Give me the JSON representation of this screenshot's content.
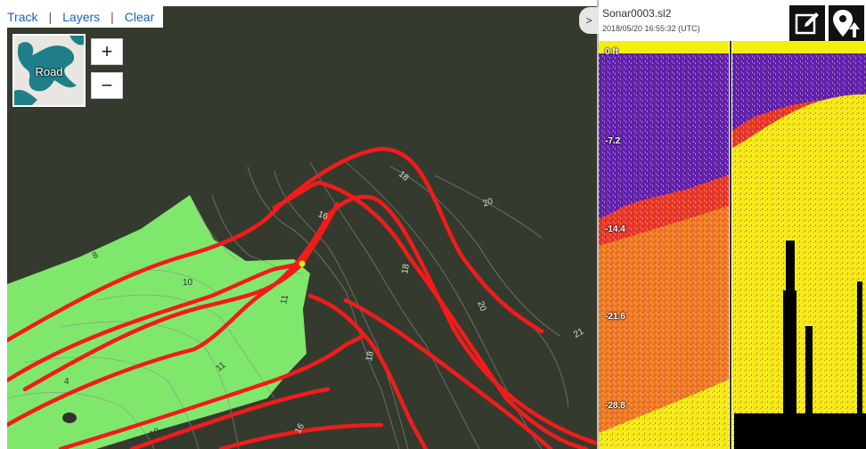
{
  "toolbar": {
    "track": "Track",
    "layers": "Layers",
    "clear": "Clear",
    "separator": "|"
  },
  "basemap": {
    "label": "Road"
  },
  "zoom": {
    "in": "+",
    "out": "−"
  },
  "map": {
    "contour_labels": [
      "15",
      "18",
      "16",
      "20",
      "8",
      "10",
      "11",
      "18",
      "20",
      "11",
      "21",
      "4",
      "18",
      "10",
      "16"
    ]
  },
  "sonar": {
    "collapse": ">",
    "file_name": "Sonar0003.sl2",
    "timestamp": "2018/05/20 16:55:32 (UTC)",
    "edit_icon": "edit-icon",
    "pin_icon": "location-pin-icon",
    "depth_labels": [
      "0 ft",
      "-7.2",
      "-14.4",
      "-21.6",
      "-28.8"
    ]
  },
  "colors": {
    "water": "#343b2e",
    "shallow": "#7fe86c",
    "track": "#f21b1b",
    "sonar_low": "#5a1fb8",
    "sonar_mid": "#e8352a",
    "sonar_high": "#f4ef10",
    "link": "#1565c0"
  }
}
